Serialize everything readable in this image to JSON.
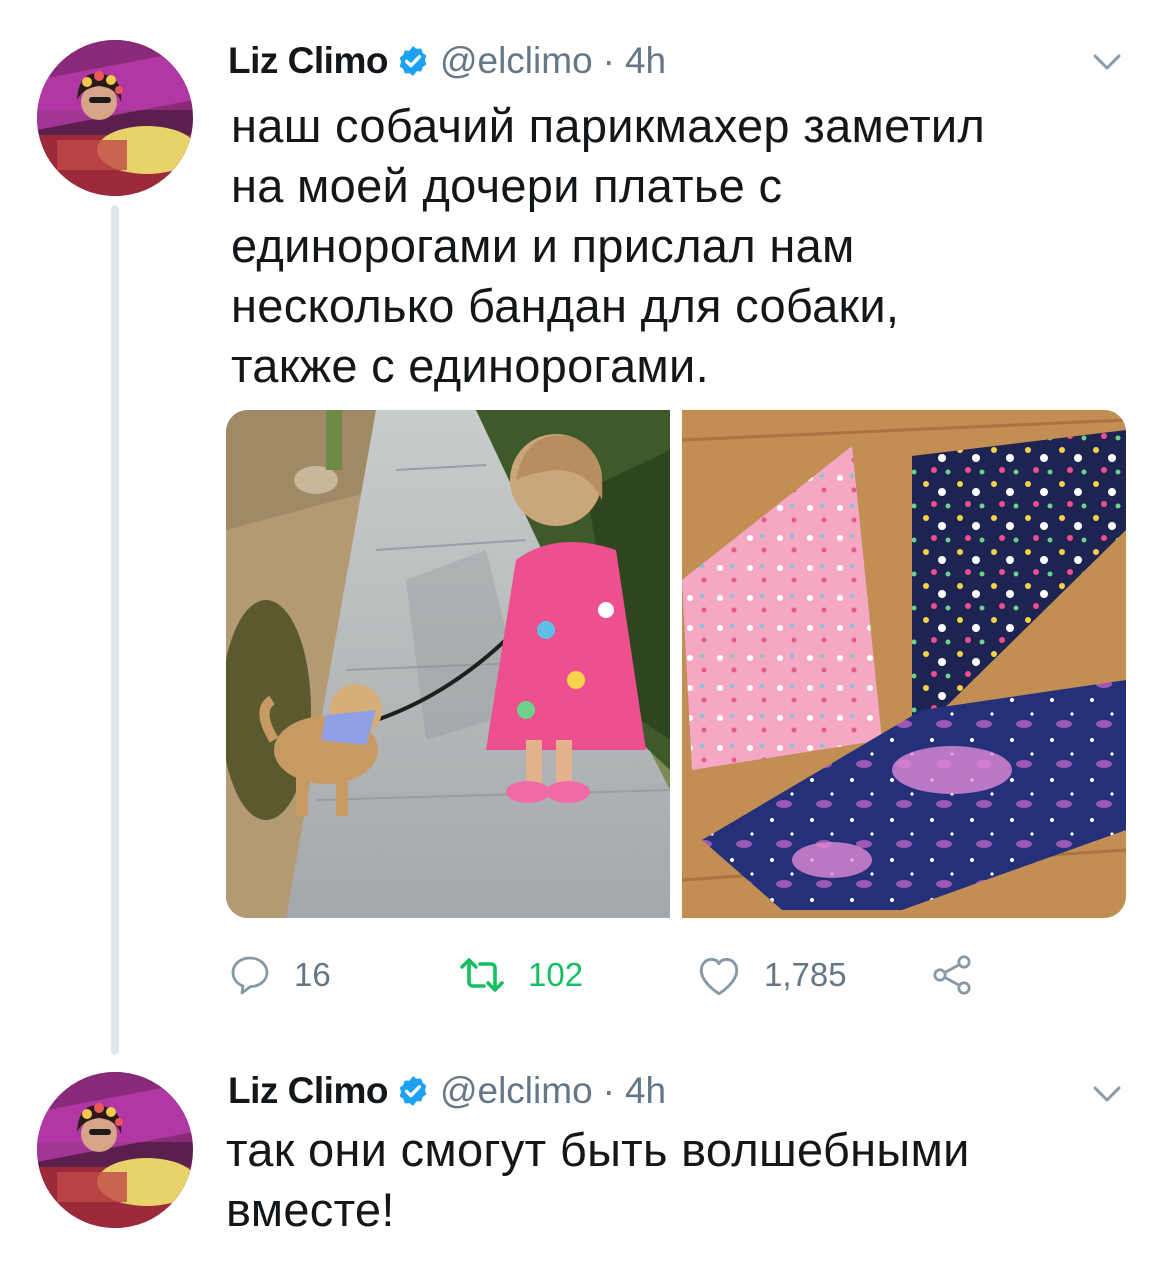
{
  "tweets": [
    {
      "author_name": "Liz Climo",
      "handle": "@elclimo",
      "separator": "·",
      "time": "4h",
      "text_lines": [
        "наш собачий парикмахер заметил",
        "на моей дочери платье с",
        "единорогами и прислал нам",
        "несколько бандан для собаки,",
        "также с единорогами."
      ],
      "replies": "16",
      "retweets": "102",
      "likes": "1,785"
    },
    {
      "author_name": "Liz Climo",
      "handle": "@elclimo",
      "separator": "·",
      "time": "4h",
      "text_lines": [
        "так они смогут быть волшебными",
        "вместе!"
      ]
    }
  ],
  "icons": {
    "verified": "verified-badge-icon",
    "menu": "chevron-down-icon",
    "reply": "reply-icon",
    "retweet": "retweet-icon",
    "like": "heart-icon",
    "share": "share-icon"
  },
  "colors": {
    "verified_blue": "#1da1f2",
    "retweeted_green": "#17bf63",
    "muted_gray": "#657786",
    "text": "#14171a",
    "thread_line": "#e1e8ed"
  }
}
